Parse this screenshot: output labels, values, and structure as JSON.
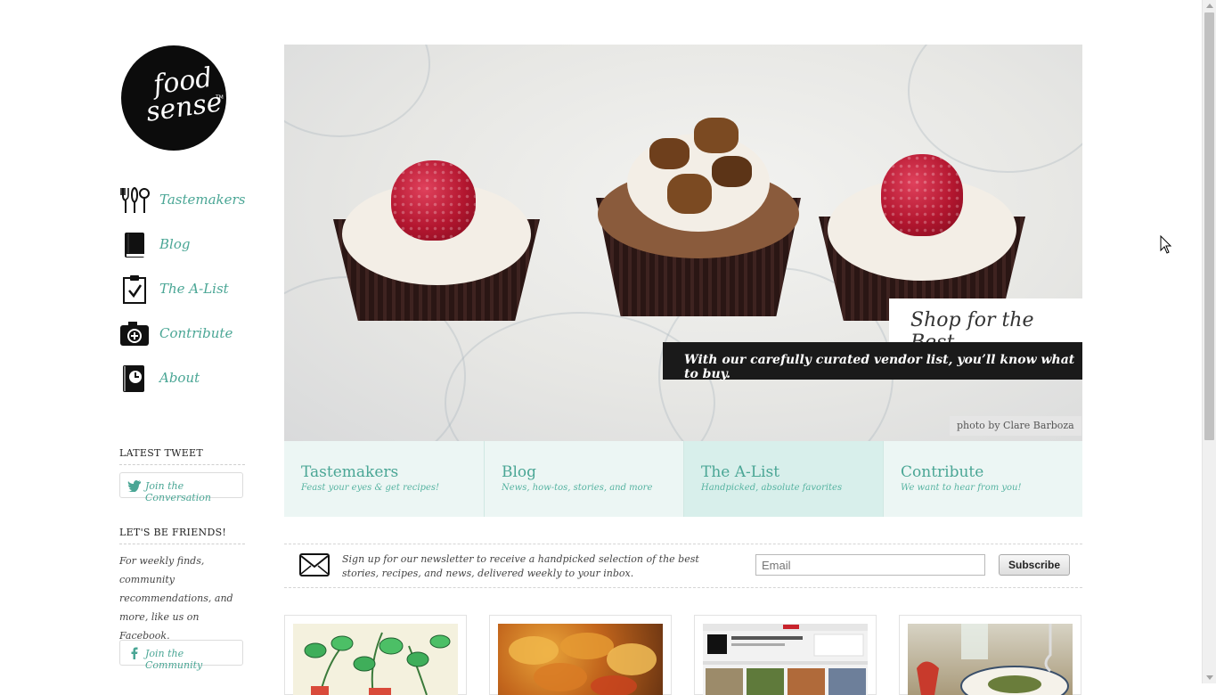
{
  "brand": {
    "logo_line1": "food",
    "logo_line2": "sense",
    "logo_tm": "TM"
  },
  "nav": {
    "items": [
      {
        "label": "Tastemakers",
        "icon": "utensils-icon"
      },
      {
        "label": "Blog",
        "icon": "book-icon"
      },
      {
        "label": "The A-List",
        "icon": "clipboard-check-icon"
      },
      {
        "label": "Contribute",
        "icon": "camera-plus-icon"
      },
      {
        "label": "About",
        "icon": "clock-book-icon"
      }
    ]
  },
  "sidebar": {
    "latest_tweet_heading": "LATEST TWEET",
    "tweet_button_label": "Join the Conversation",
    "friends_heading": "LET'S BE FRIENDS!",
    "friends_text": "For weekly finds, community recommendations, and more, like us on Facebook.",
    "facebook_button_label": "Join the Community"
  },
  "hero": {
    "title": "Shop for the Best",
    "subtitle": "With our carefully curated vendor list, you’ll know what to buy.",
    "credit": "photo by Clare Barboza"
  },
  "tabs": [
    {
      "title": "Tastemakers",
      "subtitle": "Feast your eyes & get recipes!",
      "active": false
    },
    {
      "title": "Blog",
      "subtitle": "News, how-tos, stories, and more",
      "active": false
    },
    {
      "title": "The A-List",
      "subtitle": "Handpicked, absolute favorites",
      "active": true
    },
    {
      "title": "Contribute",
      "subtitle": "We want to hear from you!",
      "active": false
    }
  ],
  "newsletter": {
    "text": "Sign up for our newsletter to receive a handpicked selection of the best stories, recipes, and news, delivered weekly to your inbox.",
    "email_placeholder": "Email",
    "subscribe_label": "Subscribe"
  },
  "colors": {
    "accent": "#4aa695",
    "tab_bg": "#ecf6f4",
    "tab_active_bg": "#d8efeb",
    "dark": "#1a1a1a"
  }
}
